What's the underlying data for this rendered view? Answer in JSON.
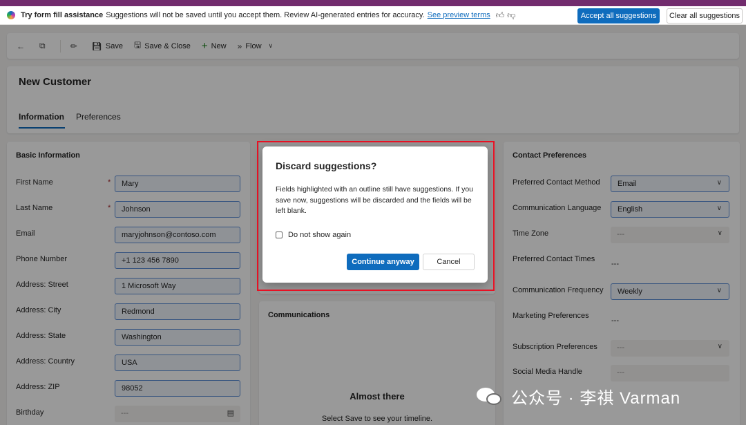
{
  "banner": {
    "title": "Try form fill assistance",
    "text": "Suggestions will not be saved until you accept them. Review AI-generated entries for accuracy.",
    "link": "See preview terms",
    "accept_label": "Accept all suggestions",
    "clear_label": "Clear all suggestions"
  },
  "commandbar": {
    "save": "Save",
    "save_close": "Save & Close",
    "new": "New",
    "flow": "Flow"
  },
  "header": {
    "title": "New Customer",
    "tabs": [
      "Information",
      "Preferences"
    ]
  },
  "basic": {
    "title": "Basic Information",
    "fields": [
      {
        "label": "First Name",
        "value": "Mary"
      },
      {
        "label": "Last Name",
        "value": "Johnson"
      },
      {
        "label": "Email",
        "value": "maryjohnson@contoso.com"
      },
      {
        "label": "Phone Number",
        "value": "+1 123 456 7890"
      },
      {
        "label": "Address: Street",
        "value": "1 Microsoft Way"
      },
      {
        "label": "Address: City",
        "value": "Redmond"
      },
      {
        "label": "Address: State",
        "value": "Washington"
      },
      {
        "label": "Address: Country",
        "value": "USA"
      },
      {
        "label": "Address: ZIP",
        "value": "98052"
      },
      {
        "label": "Birthday",
        "value": "---"
      }
    ]
  },
  "communications": {
    "title": "Communications",
    "empty_title": "Almost there",
    "empty_text": "Select Save to see your timeline."
  },
  "contact": {
    "title": "Contact Preferences",
    "fields": [
      {
        "label": "Preferred Contact Method",
        "value": "Email"
      },
      {
        "label": "Communication Language",
        "value": "English"
      },
      {
        "label": "Time Zone",
        "value": "---"
      },
      {
        "label": "Preferred Contact Times",
        "value": "---"
      },
      {
        "label": "Communication Frequency",
        "value": "Weekly"
      },
      {
        "label": "Marketing Preferences",
        "value": "---"
      },
      {
        "label": "Subscription Preferences",
        "value": "---"
      },
      {
        "label": "Social Media Handle",
        "value": "---"
      }
    ]
  },
  "dialog": {
    "title": "Discard suggestions?",
    "body": "Fields highlighted with an outline still have suggestions. If you save now, suggestions will be discarded and the fields will be left blank.",
    "checkbox_label": "Do not show again",
    "primary_label": "Continue anyway",
    "secondary_label": "Cancel"
  },
  "watermark": {
    "text": "公众号 · 李祺 Varman"
  },
  "colors": {
    "accent": "#0f6cbd",
    "top_strip": "#722c6e",
    "highlight": "#e81123"
  }
}
